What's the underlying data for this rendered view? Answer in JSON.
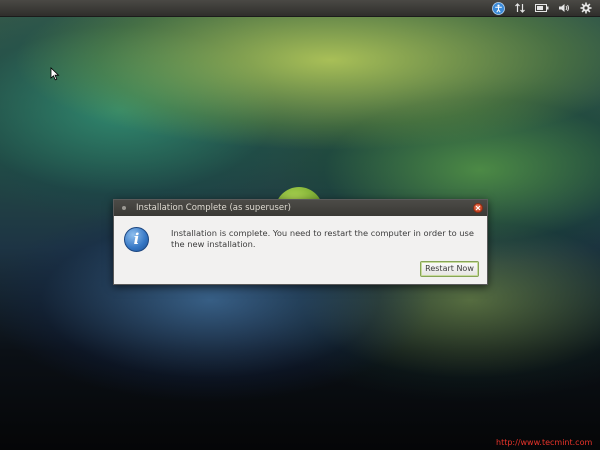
{
  "colors": {
    "panel": "#3c3b37",
    "dialog_bg": "#f2f1f0",
    "titlebar": "#45443f",
    "close_button": "#df4a22",
    "info_icon": "#3476c4",
    "accent_button_border": "#87a556",
    "watermark": "#e8332a"
  },
  "top_panel": {
    "icons": [
      "accessibility-icon",
      "network-icon",
      "battery-icon",
      "volume-icon",
      "settings-gear-icon"
    ]
  },
  "dialog": {
    "title": "Installation Complete (as superuser)",
    "icon": "info-icon",
    "icon_glyph": "i",
    "message": "Installation is complete. You need to restart the computer in order to use the new installation.",
    "button_label": "Restart Now"
  },
  "watermark": "http://www.tecmint.com"
}
